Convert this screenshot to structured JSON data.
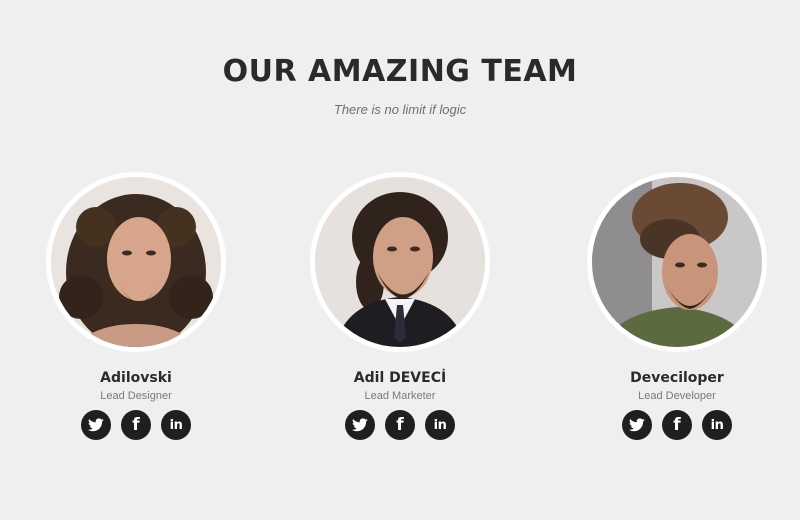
{
  "header": {
    "title": "OUR AMAZING TEAM",
    "subtitle": "There is no limit if logic"
  },
  "team": [
    {
      "name": "Adilovski",
      "role": "Lead Designer",
      "socials": [
        "twitter-icon",
        "facebook-icon",
        "linkedin-icon"
      ]
    },
    {
      "name": "Adil DEVECİ",
      "role": "Lead Marketer",
      "socials": [
        "twitter-icon",
        "facebook-icon",
        "linkedin-icon"
      ]
    },
    {
      "name": "Deveciloper",
      "role": "Lead Developer",
      "socials": [
        "twitter-icon",
        "facebook-icon",
        "linkedin-icon"
      ]
    }
  ],
  "icons": {
    "facebook_glyph": "f",
    "linkedin_glyph": "in"
  },
  "colors": {
    "background": "#f0eff0",
    "title": "#2a2a2a",
    "subtitle": "#6f6f6f",
    "social_button": "#1f1f1f",
    "avatar_border": "#ffffff"
  }
}
